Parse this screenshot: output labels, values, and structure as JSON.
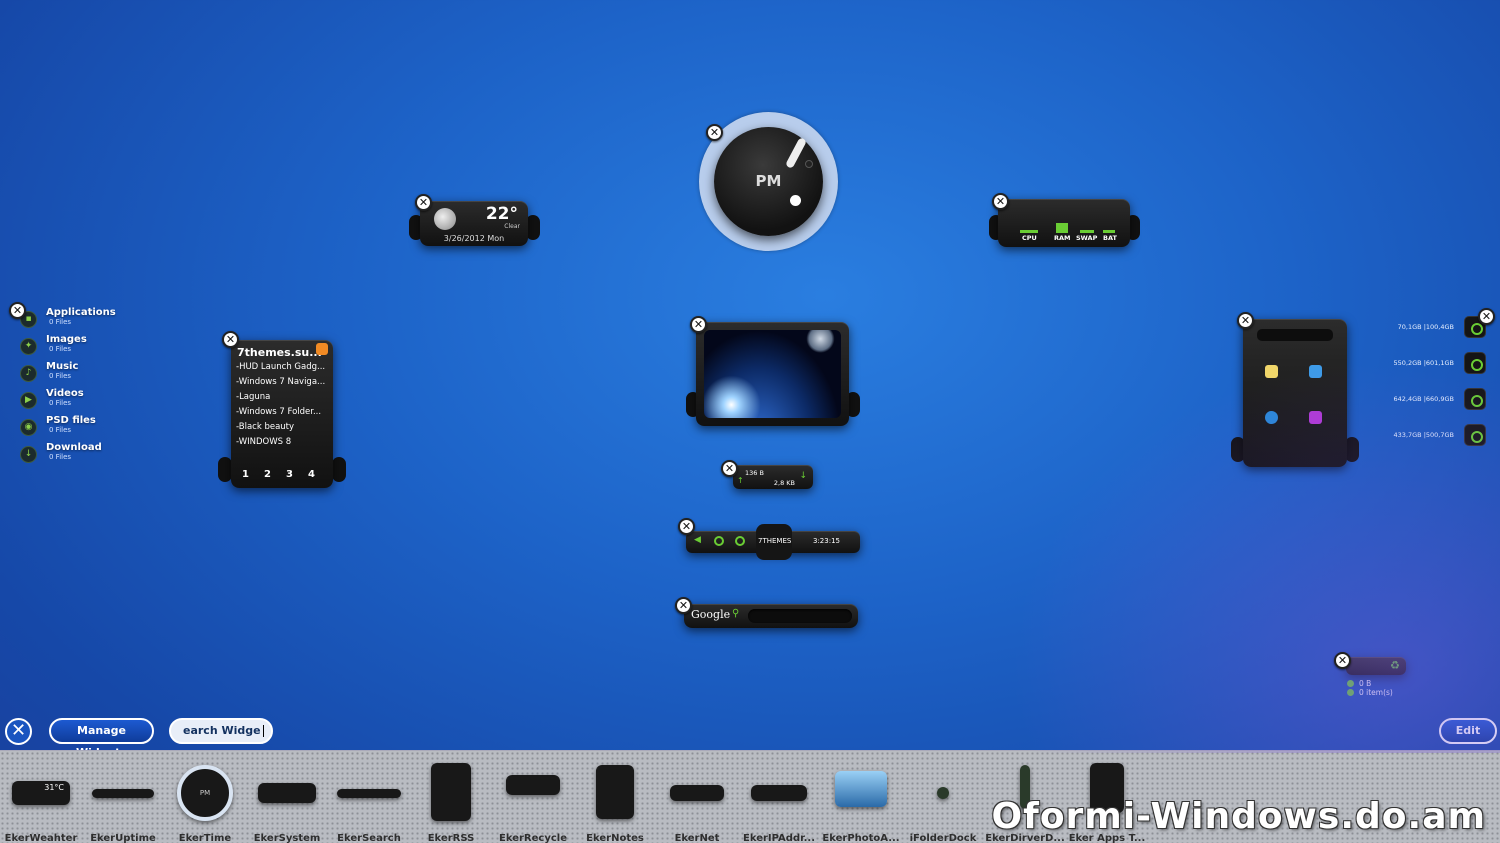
{
  "places": [
    {
      "label": "Applications",
      "count": "0 Files"
    },
    {
      "label": "Images",
      "count": "0 Files"
    },
    {
      "label": "Music",
      "count": "0 Files"
    },
    {
      "label": "Videos",
      "count": "0 Files"
    },
    {
      "label": "PSD files",
      "count": "0 Files"
    },
    {
      "label": "Download",
      "count": "0 Files"
    }
  ],
  "rss": {
    "title": "7themes.su...",
    "items": [
      "-HUD Launch Gadg...",
      "-Windows 7 Naviga...",
      "-Laguna",
      "-Windows 7 Folder...",
      "-Black beauty",
      "-WINDOWS 8"
    ],
    "pages": [
      "1",
      "2",
      "3",
      "4"
    ]
  },
  "weather": {
    "temp": "22°",
    "condition": "Clear",
    "date": "3/26/2012 Mon"
  },
  "clock": {
    "period": "PM"
  },
  "system": {
    "labels": [
      "CPU",
      "RAM",
      "SWAP",
      "BAT"
    ]
  },
  "net": {
    "up": "136 B",
    "down": "2,8 KB"
  },
  "uptime": {
    "name": "7THEMES",
    "time": "3:23:15"
  },
  "search_widget": {
    "logo": "Google"
  },
  "drives": [
    {
      "text": "70,1GB |100,4GB"
    },
    {
      "text": "550,2GB |601,1GB"
    },
    {
      "text": "642,4GB |660,9GB"
    },
    {
      "text": "433,7GB |500,7GB"
    }
  ],
  "recycle": {
    "size": "0 B",
    "items": "0 item(s)"
  },
  "controls": {
    "close_glyph": "✕",
    "manage_label": "Manage Widgets",
    "search_value": "earch Widge",
    "edit_label": "Edit"
  },
  "dock": {
    "items": [
      "EkerWeahter",
      "EkerUptime",
      "EkerTime",
      "EkerSystem",
      "EkerSearch",
      "EkerRSS",
      "EkerRecycle",
      "EkerNotes",
      "EkerNet",
      "EkerIPAddr...",
      "EkerPhotoA...",
      "iFolderDock",
      "EkerDirverD...",
      "Eker Apps T..."
    ],
    "weather_thumb_temp": "31°C",
    "clock_thumb": "PM"
  },
  "watermark": "Oformi-Windows.do.am",
  "colors": {
    "accent_green": "#6acd34",
    "desktop_blue": "#1d63c8",
    "rss_orange": "#f08a24"
  }
}
